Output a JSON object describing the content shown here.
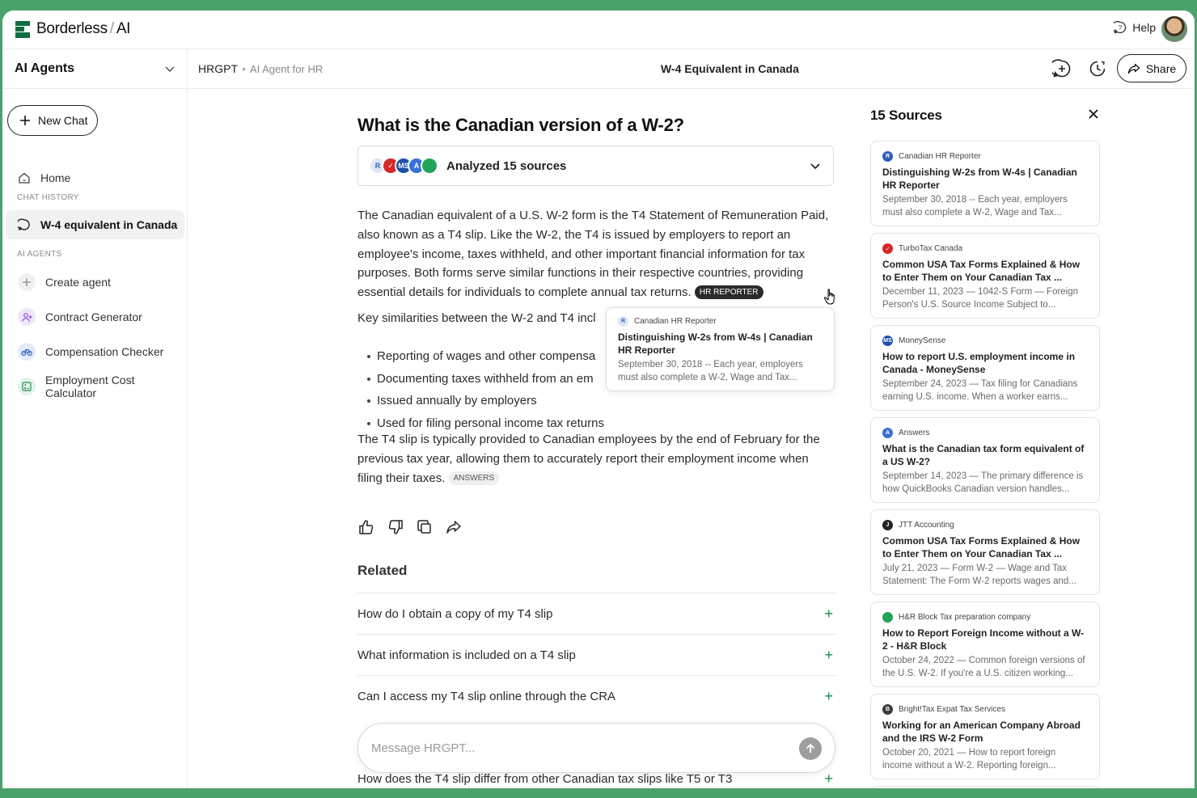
{
  "app": {
    "brand": "Borderless",
    "brand_suffix": "AI",
    "help_label": "Help"
  },
  "sidebar": {
    "section_title": "AI Agents",
    "new_chat_label": "New Chat",
    "home_label": "Home",
    "chat_history_label": "CHAT HISTORY",
    "history": [
      {
        "label": "W-4 equivalent in Canada"
      }
    ],
    "ai_agents_label": "AI AGENTS",
    "agents": [
      {
        "label": "Create agent",
        "icon": "plus-icon"
      },
      {
        "label": "Contract Generator",
        "icon": "user-plus-icon"
      },
      {
        "label": "Compensation Checker",
        "icon": "bicycle-icon"
      },
      {
        "label": "Employment Cost Calculator",
        "icon": "calculator-icon"
      }
    ]
  },
  "header": {
    "agent_name": "HRGPT",
    "agent_desc": "AI Agent for HR",
    "conversation_title": "W-4 Equivalent in Canada",
    "share_label": "Share"
  },
  "conversation": {
    "question": "What is the Canadian version of a W-2?",
    "analyzed_label": "Analyzed 15 sources",
    "answer_p1": "The Canadian equivalent of a U.S. W-2 form is the T4 Statement of Remuneration Paid, also known as a T4 slip. Like the W-2, the T4 is issued by employers to report an employee's income, taxes withheld, and other important financial information for tax purposes. Both forms serve similar functions in their respective countries, providing essential details for individuals to complete annual tax returns.",
    "citation_1": "HR REPORTER",
    "answer_p2": "Key similarities between the W-2 and T4 incl",
    "bullets": [
      "Reporting of wages and other compensa",
      "Documenting taxes withheld from an em",
      "Issued annually by employers",
      "Used for filing personal income tax returns"
    ],
    "answer_p3": "The T4 slip is typically provided to Canadian employees by the end of February for the previous tax year, allowing them to accurately report their employment income when filing their taxes.",
    "citation_2": "ANSWERS",
    "hover_card": {
      "site": "Canadian HR Reporter",
      "title": "Distinguishing W-2s from W-4s | Canadian HR Reporter",
      "snippet": "September 30, 2018 -- Each year, employers must also complete a W-2, Wage and Tax..."
    }
  },
  "related": {
    "title": "Related",
    "items": [
      "How do I obtain a copy of my T4 slip",
      "What information is included on a T4 slip",
      "Can I access my T4 slip online through the CRA",
      "How does the T4 slip differ from other Canadian tax slips like T5 or T3"
    ]
  },
  "composer": {
    "placeholder": "Message HRGPT..."
  },
  "sources": {
    "title": "15 Sources",
    "cards": [
      {
        "site": "Canadian HR Reporter",
        "title": "Distinguishing W-2s from W-4s | Canadian HR Reporter",
        "snippet": "September 30, 2018 -- Each year, employers must also complete a W-2, Wage and Tax...",
        "icon_color": "#2b5fb8",
        "icon_text": "R"
      },
      {
        "site": "TurboTax Canada",
        "title": "Common USA Tax Forms Explained & How to Enter Them on Your Canadian Tax ...",
        "snippet": "December 11, 2023 — 1042-S Form — Foreign Person's U.S. Source Income Subject to...",
        "icon_color": "#d62828",
        "icon_text": "✓"
      },
      {
        "site": "MoneySense",
        "title": "How to report U.S. employment income in Canada - MoneySense",
        "snippet": "September 24, 2023 — Tax filing for Canadians earning U.S. income. When a worker earns...",
        "icon_color": "#1f4fa6",
        "icon_text": "MS"
      },
      {
        "site": "Answers",
        "title": "What is the Canadian tax form equivalent of a US W-2?",
        "snippet": "September 14, 2023 — The primary difference is how QuickBooks Canadian version handles...",
        "icon_color": "#3a6fd8",
        "icon_text": "A"
      },
      {
        "site": "JTT Accounting",
        "title": "Common USA Tax Forms Explained & How to Enter Them on Your Canadian Tax ...",
        "snippet": "July 21, 2023 — Form W-2 — Wage and Tax Statement: The Form W-2 reports wages and...",
        "icon_color": "#222222",
        "icon_text": "J"
      },
      {
        "site": "H&R Block Tax preparation company",
        "title": "How to Report Foreign Income without a W-2 - H&R Block",
        "snippet": "October 24, 2022 — Common foreign versions of the U.S. W-2. If you're a U.S. citizen working...",
        "icon_color": "#22a35a",
        "icon_text": ""
      },
      {
        "site": "Bright!Tax Expat Tax Services",
        "title": "Working for an American Company Abroad and the IRS W-2 Form",
        "snippet": "October 20, 2021 — How to report foreign income without a W-2. Reporting foreign...",
        "icon_color": "#3b3b3b",
        "icon_text": "B"
      }
    ]
  }
}
